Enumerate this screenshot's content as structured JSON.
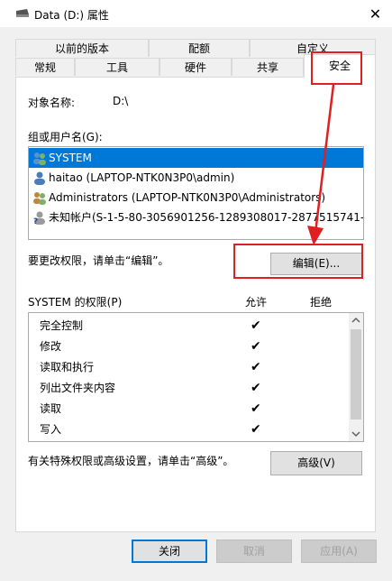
{
  "window": {
    "title": "Data (D:) 属性",
    "close_glyph": "✕"
  },
  "tabs": {
    "row1": [
      "以前的版本",
      "配额",
      "自定义"
    ],
    "row2": [
      "常规",
      "工具",
      "硬件",
      "共享",
      "安全"
    ],
    "active": "安全"
  },
  "object": {
    "label": "对象名称:",
    "value": "D:\\"
  },
  "group": {
    "label": "组或用户名(G):",
    "users": [
      {
        "name": "SYSTEM",
        "icon": "users-group-icon",
        "selected": true
      },
      {
        "name": "haitao (LAPTOP-NTK0N3P0\\admin)",
        "icon": "user-icon",
        "selected": false
      },
      {
        "name": "Administrators (LAPTOP-NTK0N3P0\\Administrators)",
        "icon": "users-group-icon",
        "selected": false
      },
      {
        "name": "未知帐户(S-1-5-80-3056901256-1289308017-2877515741-...",
        "icon": "unknown-user-icon",
        "selected": false
      }
    ]
  },
  "edit": {
    "hint": "要更改权限，请单击“编辑”。",
    "button": "编辑(E)..."
  },
  "permissions": {
    "label": "SYSTEM 的权限(P)",
    "allow_header": "允许",
    "deny_header": "拒绝",
    "rows": [
      {
        "name": "完全控制",
        "allow": "✔",
        "deny": ""
      },
      {
        "name": "修改",
        "allow": "✔",
        "deny": ""
      },
      {
        "name": "读取和执行",
        "allow": "✔",
        "deny": ""
      },
      {
        "name": "列出文件夹内容",
        "allow": "✔",
        "deny": ""
      },
      {
        "name": "读取",
        "allow": "✔",
        "deny": ""
      },
      {
        "name": "写入",
        "allow": "✔",
        "deny": ""
      }
    ]
  },
  "advanced": {
    "hint": "有关特殊权限或高级设置，请单击“高级”。",
    "button": "高级(V)"
  },
  "footer": {
    "ok": "关闭",
    "cancel": "取消",
    "apply": "应用(A)"
  },
  "colors": {
    "selection": "#0078d7",
    "annotation_red": "#e02020"
  }
}
